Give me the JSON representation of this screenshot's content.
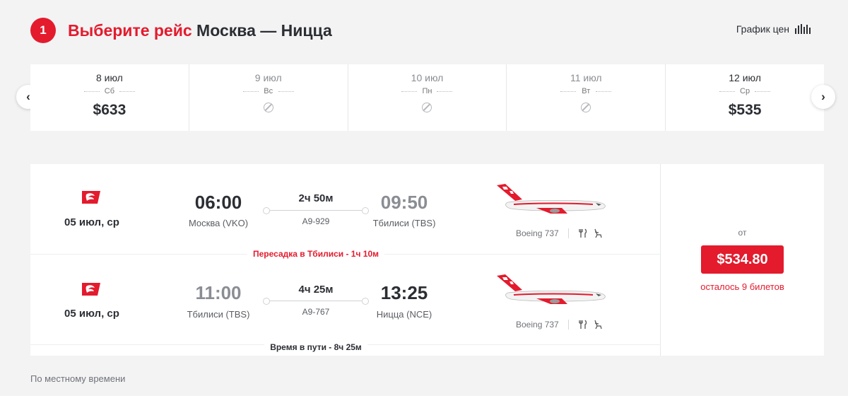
{
  "header": {
    "step_number": "1",
    "title_prefix": "Выберите рейс",
    "title_route": "Москва — Ницца",
    "price_chart_label": "График цен"
  },
  "colors": {
    "accent": "#e31b2d",
    "text": "#2b2e33"
  },
  "date_strip": {
    "dates": [
      {
        "date": "8 июл",
        "weekday": "Сб",
        "price": "$633",
        "available": true
      },
      {
        "date": "9 июл",
        "weekday": "Вс",
        "price": "",
        "available": false
      },
      {
        "date": "10 июл",
        "weekday": "Пн",
        "price": "",
        "available": false
      },
      {
        "date": "11 июл",
        "weekday": "Вт",
        "price": "",
        "available": false
      },
      {
        "date": "12 июл",
        "weekday": "Ср",
        "price": "$535",
        "available": true
      }
    ]
  },
  "flight": {
    "segments": [
      {
        "date": "05 июл, ср",
        "departure_time": "06:00",
        "departure_airport": "Москва (VKO)",
        "duration": "2ч 50м",
        "flight_number": "A9-929",
        "arrival_time": "09:50",
        "arrival_airport": "Тбилиси (TBS)",
        "aircraft": "Boeing 737"
      },
      {
        "date": "05 июл, ср",
        "departure_time": "11:00",
        "departure_airport": "Тбилиси (TBS)",
        "duration": "4ч 25м",
        "flight_number": "A9-767",
        "arrival_time": "13:25",
        "arrival_airport": "Ницца (NCE)",
        "aircraft": "Boeing 737"
      }
    ],
    "transfer_note": "Пересадка в Тбилиси - 1ч 10м",
    "total_time": "Время в пути - 8ч 25м",
    "price_from_label": "от",
    "price": "$534.80",
    "seats_left": "осталось 9 билетов"
  },
  "footnote": "По местному времени"
}
